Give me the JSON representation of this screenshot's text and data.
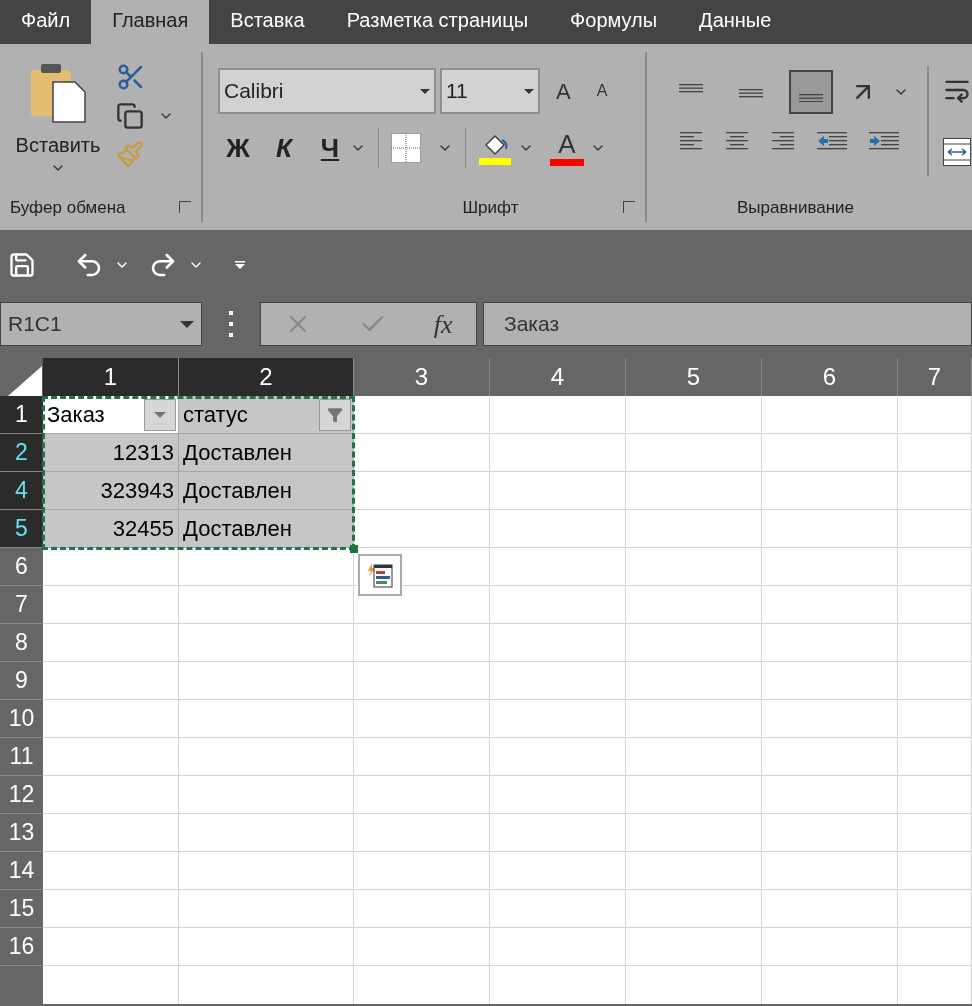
{
  "tabs": [
    {
      "label": "Файл",
      "selected": false
    },
    {
      "label": "Главная",
      "selected": true
    },
    {
      "label": "Вставка",
      "selected": false
    },
    {
      "label": "Разметка страницы",
      "selected": false
    },
    {
      "label": "Формулы",
      "selected": false
    },
    {
      "label": "Данные",
      "selected": false
    }
  ],
  "clipboard": {
    "paste_label": "Вставить",
    "group_label": "Буфер обмена"
  },
  "font": {
    "font_name": "Calibri",
    "font_size": "11",
    "grow": "A",
    "shrink": "A",
    "bold": "Ж",
    "italic": "К",
    "underline": "Ч",
    "font_color": "A",
    "group_label": "Шрифт"
  },
  "alignment": {
    "vertical": [
      {
        "selected": false
      },
      {
        "selected": false
      },
      {
        "selected": true
      }
    ],
    "group_label": "Выравнивание"
  },
  "name_box": "R1C1",
  "formula_bar": {
    "fx": "fx",
    "value": "Заказ"
  },
  "columns": [
    {
      "label": "1",
      "selected": true
    },
    {
      "label": "2",
      "selected": true
    },
    {
      "label": "3",
      "selected": false
    },
    {
      "label": "4",
      "selected": false
    },
    {
      "label": "5",
      "selected": false
    },
    {
      "label": "6",
      "selected": false
    },
    {
      "label": "7",
      "selected": false
    }
  ],
  "rows": [
    {
      "label": "1",
      "selected": true,
      "filtered": false,
      "cells": [
        {
          "kind": "header",
          "text": "Заказ",
          "active": true,
          "filter_applied": false
        },
        {
          "kind": "header",
          "text": "статус",
          "active": false,
          "filter_applied": true
        }
      ]
    },
    {
      "label": "2",
      "selected": true,
      "filtered": true,
      "cells": [
        {
          "kind": "number",
          "text": "12313",
          "active": false
        },
        {
          "kind": "text",
          "text": "Доставлен",
          "active": false
        }
      ]
    },
    {
      "label": "4",
      "selected": true,
      "filtered": true,
      "cells": [
        {
          "kind": "number",
          "text": "323943",
          "active": false
        },
        {
          "kind": "text",
          "text": "Доставлен",
          "active": false
        }
      ]
    },
    {
      "label": "5",
      "selected": true,
      "filtered": true,
      "cells": [
        {
          "kind": "number",
          "text": "32455",
          "active": false
        },
        {
          "kind": "text",
          "text": "Доставлен",
          "active": false
        }
      ]
    },
    {
      "label": "6",
      "selected": false,
      "filtered": false,
      "cells": []
    },
    {
      "label": "7",
      "selected": false,
      "filtered": false,
      "cells": []
    },
    {
      "label": "8",
      "selected": false,
      "filtered": false,
      "cells": []
    },
    {
      "label": "9",
      "selected": false,
      "filtered": false,
      "cells": []
    },
    {
      "label": "10",
      "selected": false,
      "filtered": false,
      "cells": []
    },
    {
      "label": "11",
      "selected": false,
      "filtered": false,
      "cells": []
    },
    {
      "label": "12",
      "selected": false,
      "filtered": false,
      "cells": []
    },
    {
      "label": "13",
      "selected": false,
      "filtered": false,
      "cells": []
    },
    {
      "label": "14",
      "selected": false,
      "filtered": false,
      "cells": []
    },
    {
      "label": "15",
      "selected": false,
      "filtered": false,
      "cells": []
    },
    {
      "label": "16",
      "selected": false,
      "filtered": false,
      "cells": []
    }
  ]
}
